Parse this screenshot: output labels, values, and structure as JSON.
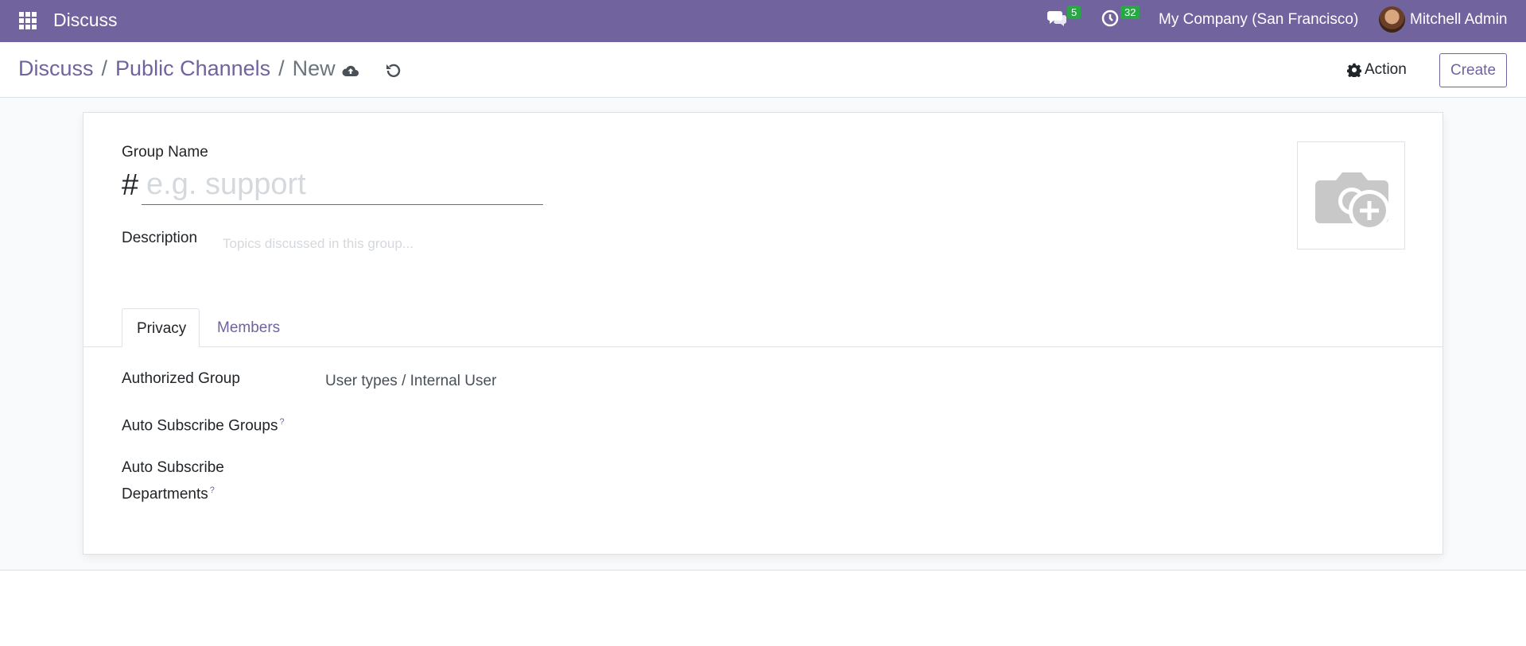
{
  "navbar": {
    "app_name": "Discuss",
    "messages_count": "5",
    "activities_count": "32",
    "company": "My Company (San Francisco)",
    "user_name": "Mitchell Admin"
  },
  "breadcrumb": {
    "items": [
      "Discuss",
      "Public Channels"
    ],
    "current": "New",
    "separator": "/"
  },
  "control_panel": {
    "action_label": "Action",
    "create_label": "Create"
  },
  "form": {
    "group_name_label": "Group Name",
    "hash": "#",
    "group_name_placeholder": "e.g. support",
    "description_label": "Description",
    "description_placeholder": "Topics discussed in this group...",
    "tabs": [
      "Privacy",
      "Members"
    ],
    "authorized_group_label": "Authorized Group",
    "authorized_group_value": "User types / Internal User",
    "auto_subscribe_groups_label": "Auto Subscribe Groups",
    "auto_subscribe_departments_label_1": "Auto Subscribe",
    "auto_subscribe_departments_label_2": "Departments",
    "help_mark": "?"
  },
  "colors": {
    "brand": "#71639e",
    "badge": "#28a745"
  }
}
